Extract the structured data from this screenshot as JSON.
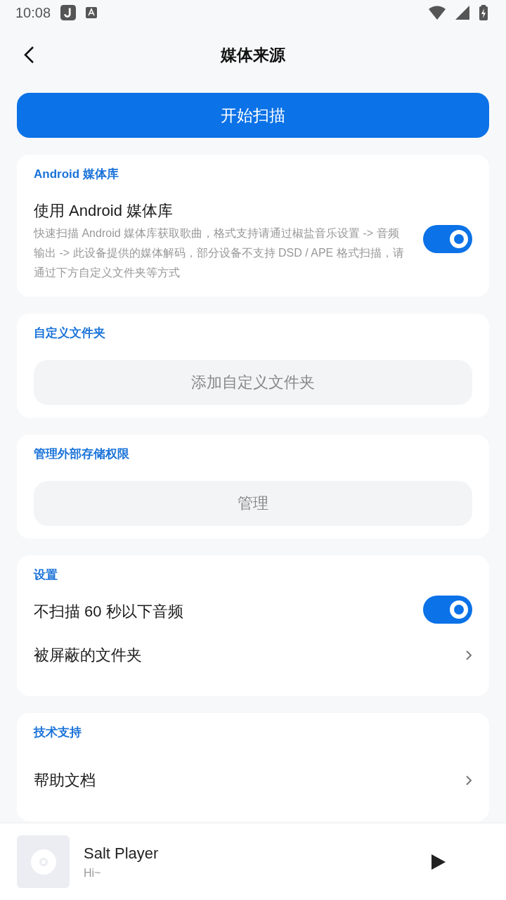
{
  "status_bar": {
    "time": "10:08"
  },
  "header": {
    "title": "媒体来源"
  },
  "scan_button": {
    "label": "开始扫描"
  },
  "sections": [
    {
      "title": "Android 媒体库",
      "items": [
        {
          "kind": "toggle",
          "label": "使用 Android 媒体库",
          "description": "快速扫描 Android 媒体库获取歌曲，格式支持请通过椒盐音乐设置 -> 音频输出 -> 此设备提供的媒体解码，部分设备不支持 DSD / APE 格式扫描，请通过下方自定义文件夹等方式",
          "on": true
        }
      ]
    },
    {
      "title": "自定义文件夹",
      "items": [
        {
          "kind": "button",
          "label": "添加自定义文件夹"
        }
      ]
    },
    {
      "title": "管理外部存储权限",
      "items": [
        {
          "kind": "button",
          "label": "管理"
        }
      ]
    },
    {
      "title": "设置",
      "items": [
        {
          "kind": "toggle",
          "label": "不扫描 60 秒以下音频",
          "on": true
        },
        {
          "kind": "link",
          "label": "被屏蔽的文件夹"
        }
      ]
    },
    {
      "title": "技术支持",
      "items": [
        {
          "kind": "link",
          "label": "帮助文档"
        }
      ]
    }
  ],
  "mini_player": {
    "title": "Salt Player",
    "subtitle": "Hi~"
  }
}
